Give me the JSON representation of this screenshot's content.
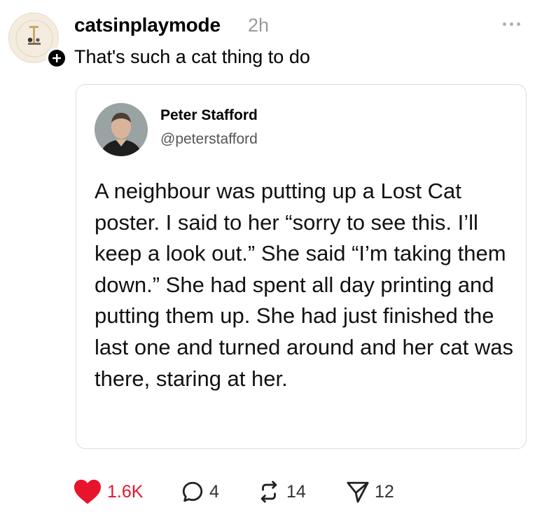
{
  "post": {
    "username": "catsinplaymode",
    "time": "2h",
    "text": "That's such a cat thing to do"
  },
  "quote": {
    "name": "Peter Stafford",
    "handle": "@peterstafford",
    "text": "A neighbour was putting up a Lost Cat poster. I said to her “sorry to see this. I’ll keep a look out.” She said “I’m taking them down.” She had spent all day printing and putting them up. She had just finished the last one and turned around and her cat was there, staring at her."
  },
  "actions": {
    "likes": "1.6K",
    "replies": "4",
    "reposts": "14",
    "shares": "12"
  },
  "icons": {
    "like": "heart-icon",
    "reply": "comment-icon",
    "repost": "repost-icon",
    "share": "send-icon",
    "more": "more-icon",
    "follow": "plus-icon"
  },
  "colors": {
    "like_active": "#e8132d",
    "muted": "#9a9a9a",
    "border": "#dcdcdc"
  }
}
